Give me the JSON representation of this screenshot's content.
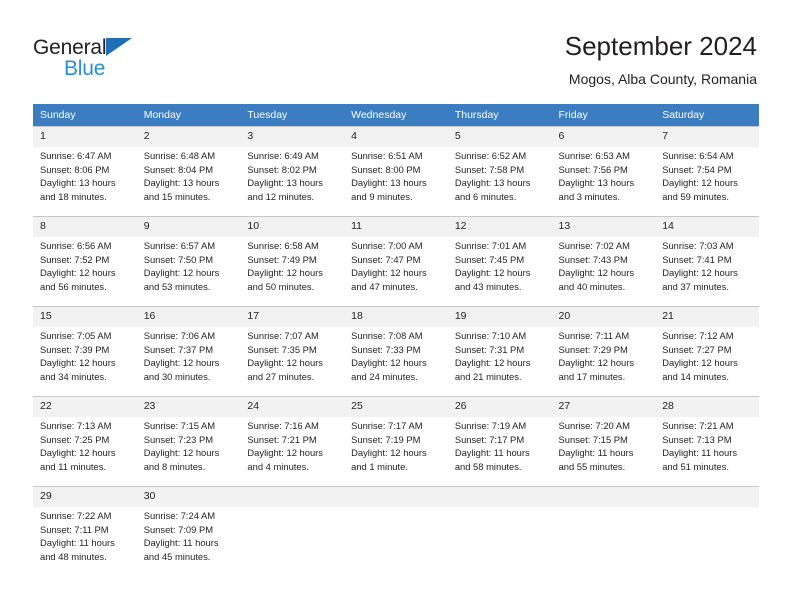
{
  "brand": {
    "name_top": "General",
    "name_bottom": "Blue",
    "triangle_color": "#1f6fb5",
    "blue_text_color": "#2a8fd4"
  },
  "header": {
    "title": "September 2024",
    "subtitle": "Mogos, Alba County, Romania"
  },
  "theme": {
    "header_row_bg": "#3b7dc0",
    "header_row_text": "#ffffff",
    "daynum_bg": "#f2f2f2",
    "grid_line": "#c8c8c8",
    "text": "#231f20"
  },
  "weekdays": [
    "Sunday",
    "Monday",
    "Tuesday",
    "Wednesday",
    "Thursday",
    "Friday",
    "Saturday"
  ],
  "weeks": [
    [
      {
        "day": "1",
        "sunrise": "Sunrise: 6:47 AM",
        "sunset": "Sunset: 8:06 PM",
        "daylight": "Daylight: 13 hours and 18 minutes."
      },
      {
        "day": "2",
        "sunrise": "Sunrise: 6:48 AM",
        "sunset": "Sunset: 8:04 PM",
        "daylight": "Daylight: 13 hours and 15 minutes."
      },
      {
        "day": "3",
        "sunrise": "Sunrise: 6:49 AM",
        "sunset": "Sunset: 8:02 PM",
        "daylight": "Daylight: 13 hours and 12 minutes."
      },
      {
        "day": "4",
        "sunrise": "Sunrise: 6:51 AM",
        "sunset": "Sunset: 8:00 PM",
        "daylight": "Daylight: 13 hours and 9 minutes."
      },
      {
        "day": "5",
        "sunrise": "Sunrise: 6:52 AM",
        "sunset": "Sunset: 7:58 PM",
        "daylight": "Daylight: 13 hours and 6 minutes."
      },
      {
        "day": "6",
        "sunrise": "Sunrise: 6:53 AM",
        "sunset": "Sunset: 7:56 PM",
        "daylight": "Daylight: 13 hours and 3 minutes."
      },
      {
        "day": "7",
        "sunrise": "Sunrise: 6:54 AM",
        "sunset": "Sunset: 7:54 PM",
        "daylight": "Daylight: 12 hours and 59 minutes."
      }
    ],
    [
      {
        "day": "8",
        "sunrise": "Sunrise: 6:56 AM",
        "sunset": "Sunset: 7:52 PM",
        "daylight": "Daylight: 12 hours and 56 minutes."
      },
      {
        "day": "9",
        "sunrise": "Sunrise: 6:57 AM",
        "sunset": "Sunset: 7:50 PM",
        "daylight": "Daylight: 12 hours and 53 minutes."
      },
      {
        "day": "10",
        "sunrise": "Sunrise: 6:58 AM",
        "sunset": "Sunset: 7:49 PM",
        "daylight": "Daylight: 12 hours and 50 minutes."
      },
      {
        "day": "11",
        "sunrise": "Sunrise: 7:00 AM",
        "sunset": "Sunset: 7:47 PM",
        "daylight": "Daylight: 12 hours and 47 minutes."
      },
      {
        "day": "12",
        "sunrise": "Sunrise: 7:01 AM",
        "sunset": "Sunset: 7:45 PM",
        "daylight": "Daylight: 12 hours and 43 minutes."
      },
      {
        "day": "13",
        "sunrise": "Sunrise: 7:02 AM",
        "sunset": "Sunset: 7:43 PM",
        "daylight": "Daylight: 12 hours and 40 minutes."
      },
      {
        "day": "14",
        "sunrise": "Sunrise: 7:03 AM",
        "sunset": "Sunset: 7:41 PM",
        "daylight": "Daylight: 12 hours and 37 minutes."
      }
    ],
    [
      {
        "day": "15",
        "sunrise": "Sunrise: 7:05 AM",
        "sunset": "Sunset: 7:39 PM",
        "daylight": "Daylight: 12 hours and 34 minutes."
      },
      {
        "day": "16",
        "sunrise": "Sunrise: 7:06 AM",
        "sunset": "Sunset: 7:37 PM",
        "daylight": "Daylight: 12 hours and 30 minutes."
      },
      {
        "day": "17",
        "sunrise": "Sunrise: 7:07 AM",
        "sunset": "Sunset: 7:35 PM",
        "daylight": "Daylight: 12 hours and 27 minutes."
      },
      {
        "day": "18",
        "sunrise": "Sunrise: 7:08 AM",
        "sunset": "Sunset: 7:33 PM",
        "daylight": "Daylight: 12 hours and 24 minutes."
      },
      {
        "day": "19",
        "sunrise": "Sunrise: 7:10 AM",
        "sunset": "Sunset: 7:31 PM",
        "daylight": "Daylight: 12 hours and 21 minutes."
      },
      {
        "day": "20",
        "sunrise": "Sunrise: 7:11 AM",
        "sunset": "Sunset: 7:29 PM",
        "daylight": "Daylight: 12 hours and 17 minutes."
      },
      {
        "day": "21",
        "sunrise": "Sunrise: 7:12 AM",
        "sunset": "Sunset: 7:27 PM",
        "daylight": "Daylight: 12 hours and 14 minutes."
      }
    ],
    [
      {
        "day": "22",
        "sunrise": "Sunrise: 7:13 AM",
        "sunset": "Sunset: 7:25 PM",
        "daylight": "Daylight: 12 hours and 11 minutes."
      },
      {
        "day": "23",
        "sunrise": "Sunrise: 7:15 AM",
        "sunset": "Sunset: 7:23 PM",
        "daylight": "Daylight: 12 hours and 8 minutes."
      },
      {
        "day": "24",
        "sunrise": "Sunrise: 7:16 AM",
        "sunset": "Sunset: 7:21 PM",
        "daylight": "Daylight: 12 hours and 4 minutes."
      },
      {
        "day": "25",
        "sunrise": "Sunrise: 7:17 AM",
        "sunset": "Sunset: 7:19 PM",
        "daylight": "Daylight: 12 hours and 1 minute."
      },
      {
        "day": "26",
        "sunrise": "Sunrise: 7:19 AM",
        "sunset": "Sunset: 7:17 PM",
        "daylight": "Daylight: 11 hours and 58 minutes."
      },
      {
        "day": "27",
        "sunrise": "Sunrise: 7:20 AM",
        "sunset": "Sunset: 7:15 PM",
        "daylight": "Daylight: 11 hours and 55 minutes."
      },
      {
        "day": "28",
        "sunrise": "Sunrise: 7:21 AM",
        "sunset": "Sunset: 7:13 PM",
        "daylight": "Daylight: 11 hours and 51 minutes."
      }
    ],
    [
      {
        "day": "29",
        "sunrise": "Sunrise: 7:22 AM",
        "sunset": "Sunset: 7:11 PM",
        "daylight": "Daylight: 11 hours and 48 minutes."
      },
      {
        "day": "30",
        "sunrise": "Sunrise: 7:24 AM",
        "sunset": "Sunset: 7:09 PM",
        "daylight": "Daylight: 11 hours and 45 minutes."
      },
      {
        "day": "",
        "sunrise": "",
        "sunset": "",
        "daylight": ""
      },
      {
        "day": "",
        "sunrise": "",
        "sunset": "",
        "daylight": ""
      },
      {
        "day": "",
        "sunrise": "",
        "sunset": "",
        "daylight": ""
      },
      {
        "day": "",
        "sunrise": "",
        "sunset": "",
        "daylight": ""
      },
      {
        "day": "",
        "sunrise": "",
        "sunset": "",
        "daylight": ""
      }
    ]
  ]
}
